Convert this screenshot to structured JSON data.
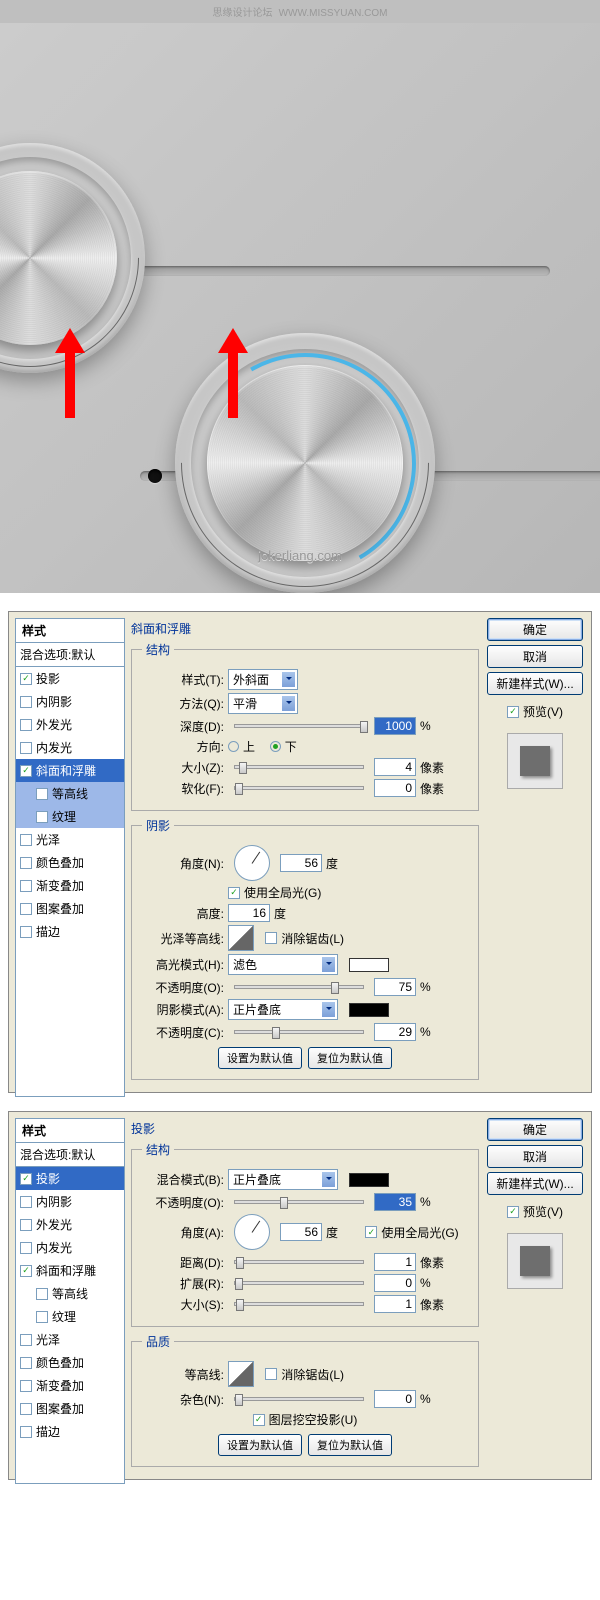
{
  "watermark": {
    "site": "思缘设计论坛",
    "url": "WWW.MISSYUAN.COM"
  },
  "credit": "jokerliang.com",
  "styles_heading": "样式",
  "blend_options": "混合选项:默认",
  "style_items": [
    {
      "label": "投影",
      "checked": true
    },
    {
      "label": "内阴影",
      "checked": false
    },
    {
      "label": "外发光",
      "checked": false
    },
    {
      "label": "内发光",
      "checked": false
    },
    {
      "label": "斜面和浮雕",
      "checked": true
    },
    {
      "label": "等高线",
      "checked": false,
      "sub": true
    },
    {
      "label": "纹理",
      "checked": false,
      "sub": true
    },
    {
      "label": "光泽",
      "checked": false
    },
    {
      "label": "颜色叠加",
      "checked": false
    },
    {
      "label": "渐变叠加",
      "checked": false
    },
    {
      "label": "图案叠加",
      "checked": false
    },
    {
      "label": "描边",
      "checked": false
    }
  ],
  "buttons": {
    "ok": "确定",
    "cancel": "取消",
    "new_style": "新建样式(W)...",
    "preview": "预览(V)",
    "default_set": "设置为默认值",
    "default_reset": "复位为默认值"
  },
  "labels": {
    "structure": "结构",
    "shadow_section": "阴影",
    "quality": "品质",
    "style": "样式(T):",
    "method": "方法(Q):",
    "depth": "深度(D):",
    "direction": "方向:",
    "up": "上",
    "down": "下",
    "size": "大小(Z):",
    "soften": "软化(F):",
    "angle": "角度(N):",
    "angle_a": "角度(A):",
    "altitude": "高度:",
    "use_global": "使用全局光(G)",
    "gloss_contour": "光泽等高线:",
    "antialias": "消除锯齿(L)",
    "hilite_mode": "高光模式(H):",
    "opacity": "不透明度(O):",
    "opacity_c": "不透明度(C):",
    "shadow_mode": "阴影模式(A):",
    "blend_mode": "混合模式(B):",
    "distance": "距离(D):",
    "spread": "扩展(R):",
    "size_s": "大小(S):",
    "contour": "等高线:",
    "noise": "杂色(N):",
    "knockout": "图层挖空投影(U)",
    "deg": "度",
    "px": "像素",
    "pct": "%"
  },
  "panel1": {
    "title": "斜面和浮雕",
    "style_val": "外斜面",
    "method_val": "平滑",
    "depth": "1000",
    "size": "4",
    "soften": "0",
    "angle": "56",
    "altitude": "16",
    "hilite_mode": "滤色",
    "hilite_opacity": "75",
    "shadow_mode": "正片叠底",
    "shadow_opacity": "29"
  },
  "panel2": {
    "title": "投影",
    "blend_mode": "正片叠底",
    "opacity": "35",
    "angle": "56",
    "distance": "1",
    "spread": "0",
    "size": "1",
    "noise": "0"
  }
}
